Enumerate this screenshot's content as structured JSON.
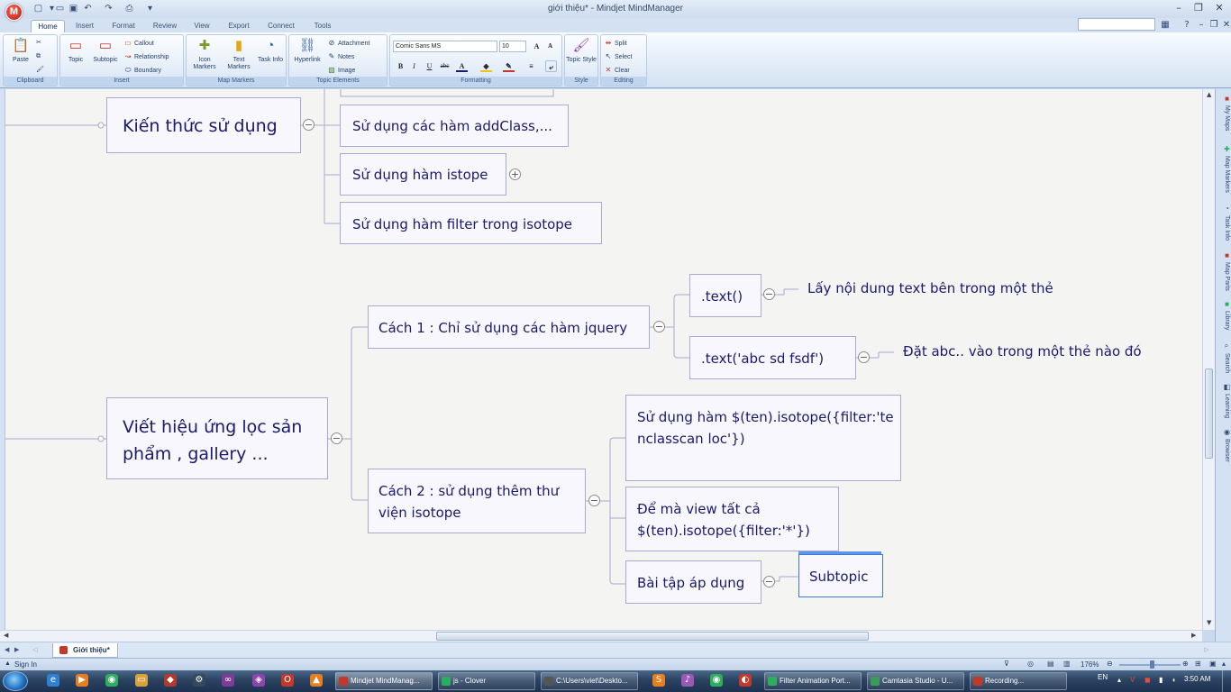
{
  "window": {
    "title": "giới thiệu* - Mindjet MindManager",
    "logo": "M"
  },
  "ribbon": {
    "tabs": [
      "Home",
      "Insert",
      "Format",
      "Review",
      "View",
      "Export",
      "Connect",
      "Tools"
    ],
    "active_tab": "Home",
    "groups": {
      "clipboard": {
        "label": "Clipboard",
        "paste": "Paste"
      },
      "insert": {
        "label": "Insert",
        "topic": "Topic",
        "subtopic": "Subtopic",
        "callout": "Callout",
        "relationship": "Relationship",
        "boundary": "Boundary"
      },
      "map_markers": {
        "label": "Map Markers",
        "icon_markers": "Icon Markers",
        "text_markers": "Text Markers",
        "task_info": "Task Info"
      },
      "topic_elements": {
        "label": "Topic Elements",
        "hyperlink": "Hyperlink",
        "attachment": "Attachment",
        "notes": "Notes",
        "image": "Image"
      },
      "formatting": {
        "label": "Formatting",
        "font": "Comic Sans MS",
        "size": "10"
      },
      "style": {
        "label": "Style",
        "topic_style": "Topic Style"
      },
      "editing": {
        "label": "Editing",
        "split": "Split",
        "select": "Select",
        "clear": "Clear"
      }
    }
  },
  "map": {
    "topics": {
      "kien_thuc": "Kiến thức sử dụng",
      "addclass": "Sử dụng các hàm addClass,...",
      "istope": "Sử dụng hàm istope",
      "filter": "Sử dụng hàm filter trong isotope",
      "viet_hieu_ung": "Viết hiệu ứng lọc sản phẩm , gallery ...",
      "cach1": "Cách 1 : Chỉ sử dụng các hàm jquery",
      "text_empty": ".text()",
      "text_empty_note": "Lấy nội dung text bên trong một thẻ",
      "text_abc": ".text('abc sd fsdf')",
      "text_abc_note": "Đặt abc.. vào trong một thẻ nào đó",
      "cach2": "Cách 2 : sử dụng thêm thư viện isotope",
      "su_dung_ham": "Sử dụng hàm $(ten).isotope({filter:'tenclasscan loc'})",
      "de_ma_view": "Để mà view tất cả $(ten).isotope({filter:'*'})",
      "bai_tap": "Bài tập áp dụng",
      "subtopic": "Subtopic"
    }
  },
  "task_pane_tabs": [
    "My Maps",
    "Map Markers",
    "Task Info",
    "Map Parts",
    "Library",
    "Search",
    "Learning",
    "Browser"
  ],
  "document_tab": "Giới thiệu*",
  "status": {
    "sign_in": "Sign In",
    "zoom": "176%"
  },
  "taskbar": {
    "tasks": [
      "Mindjet MindManag...",
      "js - Clover",
      "C:\\Users\\viet\\Deskto...",
      "Filter Animation Port...",
      "Camtasia Studio - U...",
      "Recording..."
    ],
    "language": "EN",
    "clock": "3:50 AM"
  },
  "colors": {
    "node_border": "#a7a9d8",
    "node_text": "#1a1a6e",
    "canvas_bg": "#f4f4f2",
    "selection": "#3b7ad8"
  }
}
